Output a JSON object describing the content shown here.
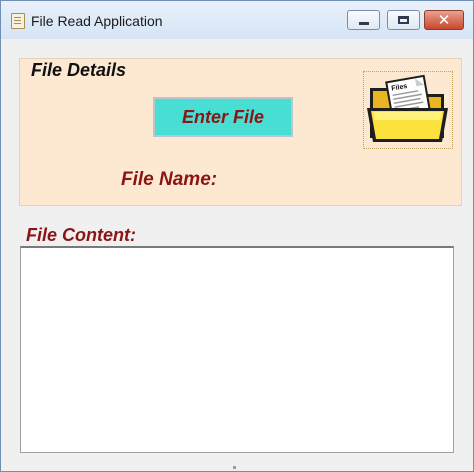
{
  "window": {
    "title": "File Read Application",
    "controls": {
      "minimize": "minimize",
      "maximize": "maximize",
      "close": "✕"
    }
  },
  "file_details": {
    "title": "File Details",
    "enter_button": "Enter File",
    "file_name_label": "File Name:",
    "file_name_value": "",
    "folder_icon_label": "Files"
  },
  "file_content": {
    "label": "File Content:",
    "text": ""
  },
  "colors": {
    "panel_bg": "#fde9d2",
    "button_bg": "#49ded3",
    "label_color": "#8b1515"
  }
}
